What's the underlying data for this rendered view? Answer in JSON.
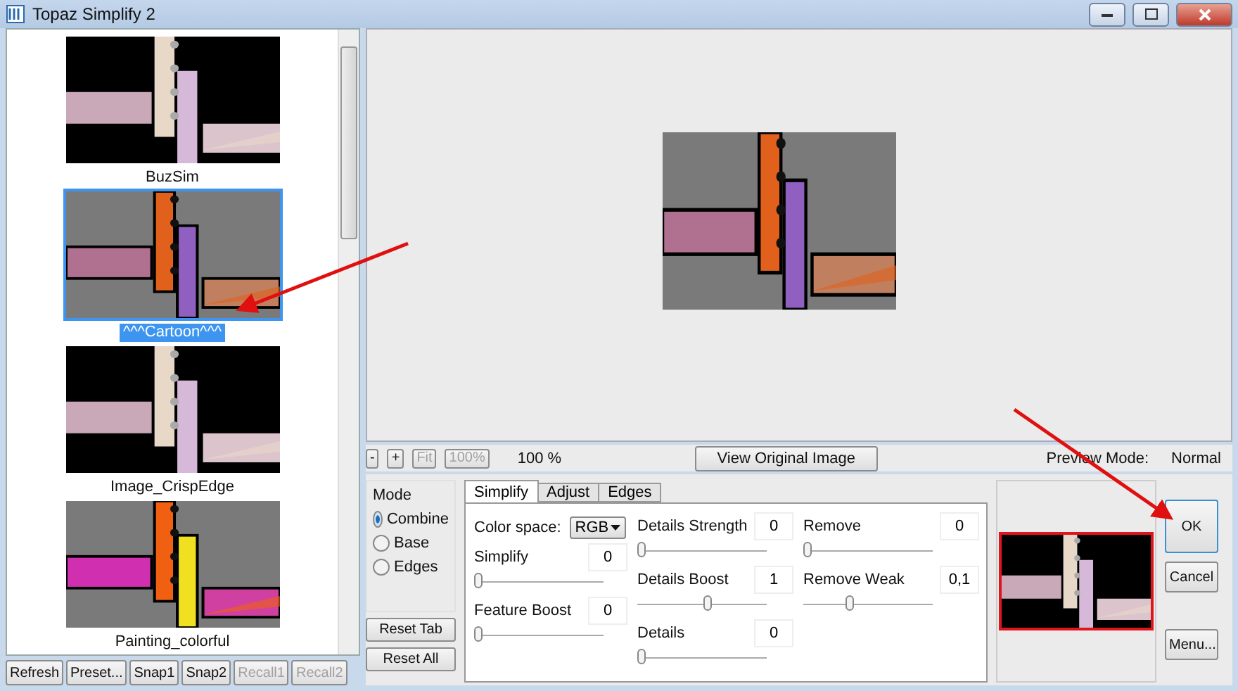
{
  "window": {
    "title": "Topaz Simplify 2"
  },
  "presets": [
    {
      "label": "BuzSim",
      "selected": false
    },
    {
      "label": "^^^Cartoon^^^",
      "selected": true
    },
    {
      "label": "Image_CrispEdge",
      "selected": false
    },
    {
      "label": "Painting_colorful",
      "selected": false
    }
  ],
  "list_buttons": [
    {
      "label": "Refresh",
      "disabled": false
    },
    {
      "label": "Preset...",
      "disabled": false
    },
    {
      "label": "Snap1",
      "disabled": false
    },
    {
      "label": "Snap2",
      "disabled": false
    },
    {
      "label": "Recall1",
      "disabled": true
    },
    {
      "label": "Recall2",
      "disabled": true
    }
  ],
  "zoom_bar": {
    "buttons": [
      {
        "label": "-",
        "disabled": false
      },
      {
        "label": "+",
        "disabled": false
      },
      {
        "label": "Fit",
        "disabled": true
      },
      {
        "label": "100%",
        "disabled": true
      }
    ],
    "zoom": "100 %",
    "view_original": "View Original Image",
    "preview_mode_label": "Preview Mode:",
    "preview_mode": "Normal"
  },
  "mode": {
    "title": "Mode",
    "options": [
      {
        "label": "Combine",
        "selected": true
      },
      {
        "label": "Base",
        "selected": false
      },
      {
        "label": "Edges",
        "selected": false
      }
    ]
  },
  "reset_buttons": [
    "Reset Tab",
    "Reset All"
  ],
  "tabs": [
    {
      "label": "Simplify",
      "selected": true
    },
    {
      "label": "Adjust",
      "selected": false
    },
    {
      "label": "Edges",
      "selected": false
    }
  ],
  "color_space": {
    "label": "Color space:",
    "value": "RGB"
  },
  "slider_columns": [
    [
      {
        "name": "Simplify",
        "value": "0",
        "level": 0
      },
      {
        "name": "Feature Boost",
        "value": "0",
        "level": 0
      }
    ],
    [
      {
        "name": "Details Strength",
        "value": "0",
        "level": 0
      },
      {
        "name": "Details Boost",
        "value": "1",
        "level": 0.55
      },
      {
        "name": "Details",
        "value": "0",
        "level": 0
      }
    ],
    [
      {
        "name": "Remove",
        "value": "0",
        "level": 0
      },
      {
        "name": "Remove Weak",
        "value": "0,1",
        "level": 0.35
      }
    ]
  ],
  "dialog_buttons": [
    {
      "label": "OK",
      "focused": true
    },
    {
      "label": "Cancel",
      "focused": false
    },
    {
      "label": "Menu...",
      "focused": false
    }
  ]
}
